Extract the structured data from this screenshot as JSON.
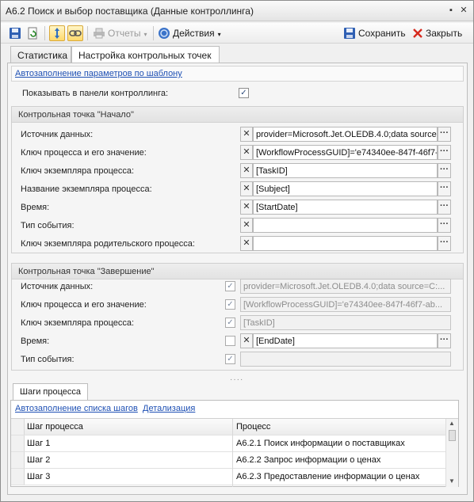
{
  "window": {
    "title": "А6.2 Поиск и выбор поставщика (Данные контроллинга)",
    "btn_minimize": "▪",
    "btn_maximize": "□",
    "btn_close": "✕"
  },
  "toolbar": {
    "reports_label": "Отчеты",
    "actions_label": "Действия",
    "save_label": "Сохранить",
    "close_label": "Закрыть",
    "caret": "▾"
  },
  "tabs": [
    {
      "label": "Статистика"
    },
    {
      "label": "Настройка контрольных точек"
    }
  ],
  "settings": {
    "autofill_link": "Автозаполнение параметров по шаблону",
    "show_in_panel_label": "Показывать в панели контроллинга:",
    "show_in_panel_checked": "✓"
  },
  "start_group": {
    "title": "Контрольная точка \"Начало\"",
    "rows": [
      {
        "label": "Источник данных:",
        "value": "provider=Microsoft.Jet.OLEDB.4.0;data source"
      },
      {
        "label": "Ключ процесса и его значение:",
        "value": "[WorkflowProcessGUID]='e74340ee-847f-46f7-"
      },
      {
        "label": "Ключ экземпляра процесса:",
        "value": "[TaskID]"
      },
      {
        "label": "Название экземпляра процесса:",
        "value": "[Subject]"
      },
      {
        "label": "Время:",
        "value": "[StartDate]"
      },
      {
        "label": "Тип события:",
        "value": ""
      },
      {
        "label": "Ключ экземпляра родительского процесса:",
        "value": ""
      }
    ]
  },
  "end_group": {
    "title": "Контрольная точка \"Завершение\"",
    "rows": [
      {
        "label": "Источник данных:",
        "value": "provider=Microsoft.Jet.OLEDB.4.0;data source=C:...",
        "checked": "✓"
      },
      {
        "label": "Ключ процесса и его значение:",
        "value": "[WorkflowProcessGUID]='e74340ee-847f-46f7-ab...",
        "checked": "✓"
      },
      {
        "label": "Ключ экземпляра процесса:",
        "value": "[TaskID]",
        "checked": "✓"
      },
      {
        "label": "Время:",
        "value": "[EndDate]",
        "checked": ""
      },
      {
        "label": "Тип события:",
        "value": "",
        "checked": "✓"
      }
    ]
  },
  "common": {
    "clear_glyph": "✕",
    "ellipsis": "···",
    "splitter": "····"
  },
  "steps": {
    "tab_label": "Шаги процесса",
    "autofill_link": "Автозаполнение списка шагов",
    "details_link": "Детализация",
    "columns": [
      "Шаг процесса",
      "Процесс"
    ],
    "rows": [
      [
        "Шаг 1",
        "А6.2.1 Поиск информации о поставщиках"
      ],
      [
        "Шаг 2",
        "А6.2.2 Запрос информации о ценах"
      ],
      [
        "Шаг 3",
        "А6.2.3 Предоставление информации о ценах"
      ]
    ],
    "scroll_up": "▲",
    "scroll_down": "▼"
  }
}
